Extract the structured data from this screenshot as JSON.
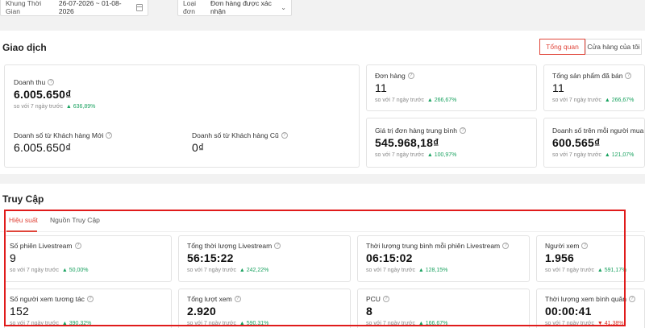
{
  "filters": {
    "period_label": "Khung Thời Gian",
    "period_value": "26-07-2026 ~ 01-08-2026",
    "order_type_label": "Loại đơn",
    "order_type_value": "Đơn hàng được xác nhận"
  },
  "transactions": {
    "title": "Giao dịch",
    "toggle": [
      "Tổng quan",
      "Cửa hàng của tôi"
    ],
    "revenue": {
      "label": "Doanh thu",
      "value": "6.005.650₫",
      "compare": "so với 7 ngày trước",
      "change": "▲ 636,89%"
    },
    "new_customer_sales": {
      "label": "Doanh số từ Khách hàng Mới",
      "value": "6.005.650₫"
    },
    "old_customer_sales": {
      "label": "Doanh số từ Khách hàng Cũ",
      "value": "0₫"
    },
    "orders": {
      "label": "Đơn hàng",
      "value": "11",
      "compare": "so với 7 ngày trước",
      "change": "▲ 266,67%"
    },
    "products_sold": {
      "label": "Tổng sản phẩm đã bán",
      "value": "11",
      "compare": "so với 7 ngày trước",
      "change": "▲ 266,67%"
    },
    "avg_order_value": {
      "label": "Giá trị đơn hàng trung bình",
      "value": "545.968,18₫",
      "compare": "so với 7 ngày trước",
      "change": "▲ 100,97%"
    },
    "sales_per_buyer": {
      "label": "Doanh số trên mỗi người mua",
      "value": "600.565₫",
      "compare": "so với 7 ngày trước",
      "change": "▲ 121,07%"
    }
  },
  "access": {
    "title": "Truy Cập",
    "tabs": [
      "Hiệu suất",
      "Nguồn Truy Cập"
    ],
    "metrics": [
      {
        "label": "Số phiên Livestream",
        "value": "9",
        "compare": "so với 7 ngày trước",
        "change": "▲ 50,00%"
      },
      {
        "label": "Tổng thời lượng Livestream",
        "value": "56:15:22",
        "compare": "so với 7 ngày trước",
        "change": "▲ 242,22%"
      },
      {
        "label": "Thời lượng trung bình mỗi phiên Livestream",
        "value": "06:15:02",
        "compare": "so với 7 ngày trước",
        "change": "▲ 128,15%"
      },
      {
        "label": "Người xem",
        "value": "1.956",
        "compare": "so với 7 ngày trước",
        "change": "▲ 591,17%"
      },
      {
        "label": "Số người xem tương tác",
        "value": "152",
        "compare": "so với 7 ngày trước",
        "change": "▲ 390,32%"
      },
      {
        "label": "Tổng lượt xem",
        "value": "2.920",
        "compare": "so với 7 ngày trước",
        "change": "▲ 590,31%"
      },
      {
        "label": "PCU",
        "value": "8",
        "compare": "so với 7 ngày trước",
        "change": "▲ 166,67%"
      },
      {
        "label": "Thời lượng xem bình quân",
        "value": "00:00:41",
        "compare": "so với 7 ngày trước",
        "change": "▼ 41,38%"
      }
    ]
  },
  "colors": {
    "accent": "#e0453a",
    "up": "#1aa260",
    "down": "#d93025",
    "highlight_box": "#e01b1b"
  }
}
